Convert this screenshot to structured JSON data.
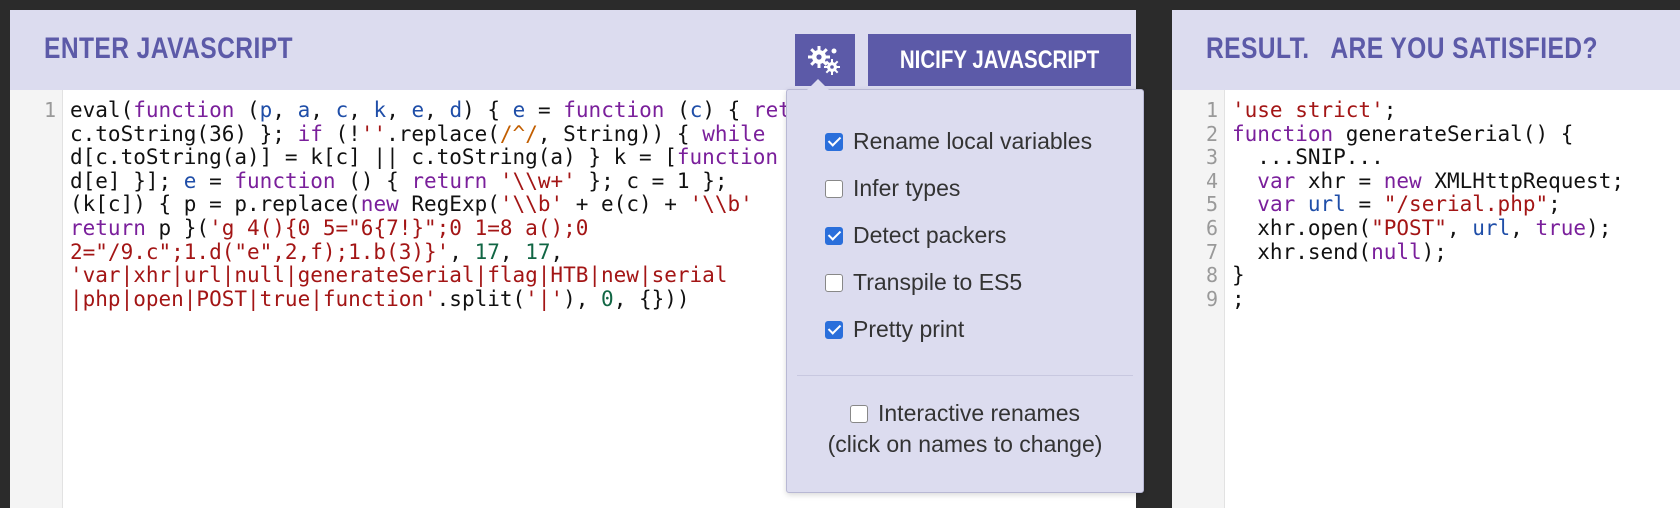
{
  "left_panel": {
    "title": "ENTER JAVASCRIPT",
    "nicify_label": "NICIFY JAVASCRIPT",
    "settings_icon": "gears-icon",
    "line_numbers": [
      "1"
    ]
  },
  "right_panel": {
    "title": "RESULT.   ARE YOU SATISFIED?",
    "line_numbers": [
      "1",
      "2",
      "3",
      "4",
      "5",
      "6",
      "7",
      "8",
      "9"
    ]
  },
  "options": {
    "items": [
      {
        "label": "Rename local variables",
        "checked": true
      },
      {
        "label": "Infer types",
        "checked": false
      },
      {
        "label": "Detect packers",
        "checked": true
      },
      {
        "label": "Transpile to ES5",
        "checked": false
      },
      {
        "label": "Pretty print",
        "checked": true
      }
    ],
    "interactive_label": "Interactive renames",
    "interactive_checked": false,
    "interactive_hint": "(click on names to change)"
  },
  "colors": {
    "accent": "#5c5aa8",
    "header_bg": "#dcdcef"
  }
}
